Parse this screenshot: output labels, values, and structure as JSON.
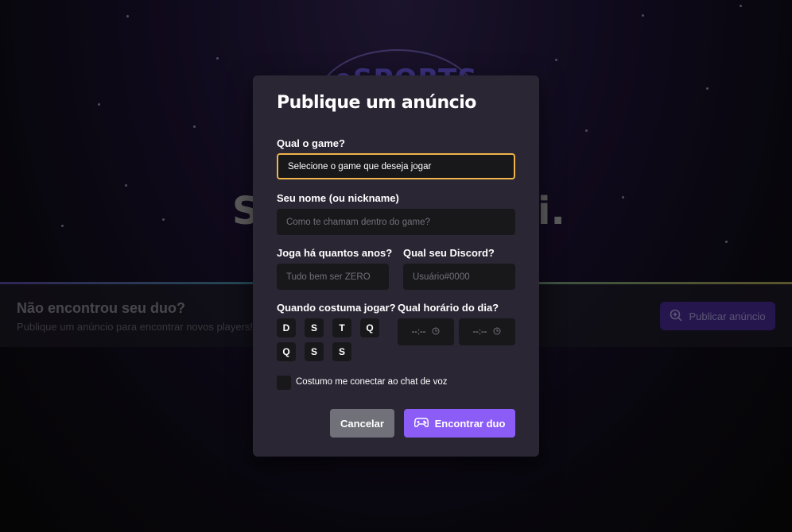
{
  "background": {
    "hero_left_fragment": "S",
    "hero_right_fragment": "i.",
    "logo_text": "eSPORTS",
    "banner": {
      "title": "Não encontrou seu duo?",
      "subtitle": "Publique um anúncio para encontrar novos players!",
      "button_label": "Publicar anúncio",
      "button_icon": "magnifying-glass-plus-icon"
    }
  },
  "modal": {
    "title": "Publique um anúncio",
    "game": {
      "label": "Qual o game?",
      "value": "Selecione o game que deseja jogar"
    },
    "name": {
      "label": "Seu nome (ou nickname)",
      "placeholder": "Como te chamam dentro do game?"
    },
    "years": {
      "label": "Joga há quantos anos?",
      "placeholder": "Tudo bem ser ZERO"
    },
    "discord": {
      "label": "Qual seu Discord?",
      "placeholder": "Usuário#0000"
    },
    "days": {
      "label": "Quando costuma jogar?",
      "items": [
        "D",
        "S",
        "T",
        "Q",
        "Q",
        "S",
        "S"
      ]
    },
    "hours": {
      "label": "Qual horário do dia?",
      "start": "--:--",
      "end": "--:--"
    },
    "voice_chat_label": "Costumo me conectar ao chat de voz",
    "cancel_label": "Cancelar",
    "submit_label": "Encontrar duo",
    "submit_icon": "game-controller-icon"
  },
  "colors": {
    "accent": "#8b5cf6",
    "focus": "#f0b44a",
    "modal_bg": "#2a2634",
    "input_bg": "#18181b"
  }
}
